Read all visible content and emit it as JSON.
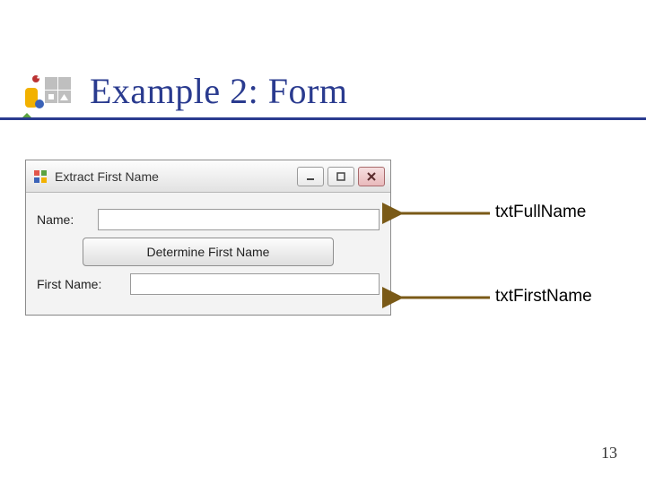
{
  "slide": {
    "title": "Example 2: Form",
    "page_number": "13"
  },
  "form": {
    "window_title": "Extract First Name",
    "name_label": "Name:",
    "first_name_label": "First Name:",
    "button_label": "Determine First Name",
    "txtFullName_value": "",
    "txtFirstName_value": ""
  },
  "callouts": {
    "full_name": "txtFullName",
    "first_name": "txtFirstName"
  }
}
